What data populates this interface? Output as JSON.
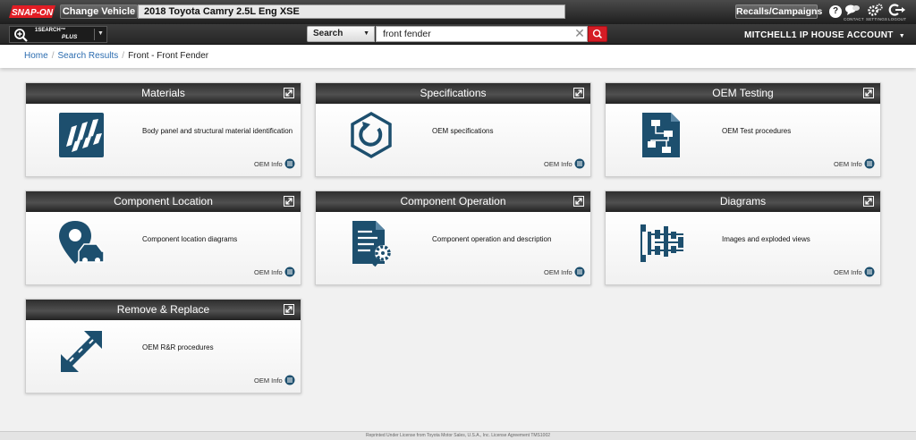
{
  "header": {
    "logo": "SNAP-ON",
    "change_vehicle": "Change Vehicle",
    "vehicle": "2018 Toyota Camry 2.5L Eng XSE",
    "recalls": "Recalls/Campaigns",
    "help": "?",
    "icons": [
      {
        "name": "contact-icon",
        "label": "CONTACT"
      },
      {
        "name": "settings-icon",
        "label": "SETTINGS"
      },
      {
        "name": "logout-icon",
        "label": "LOGOUT"
      }
    ]
  },
  "searchbar": {
    "onesearch_line1": "1SEARCH™",
    "onesearch_line2": "PLUS",
    "type_selected": "Search",
    "query": "front fender",
    "account": "MITCHELL1 IP HOUSE ACCOUNT"
  },
  "breadcrumb": {
    "items": [
      "Home",
      "Search Results",
      "Front - Front Fender"
    ]
  },
  "cards": [
    {
      "title": "Materials",
      "icon": "checkered-flag-icon",
      "desc": "Body panel and structural material identification",
      "oem": "OEM Info"
    },
    {
      "title": "Specifications",
      "icon": "bolt-rotation-icon",
      "desc": "OEM specifications",
      "oem": "OEM Info"
    },
    {
      "title": "OEM Testing",
      "icon": "flowchart-document-icon",
      "desc": "OEM Test procedures",
      "oem": "OEM Info"
    },
    {
      "title": "Component Location",
      "icon": "map-pin-car-icon",
      "desc": "Component location diagrams",
      "oem": "OEM Info"
    },
    {
      "title": "Component Operation",
      "icon": "document-gear-icon",
      "desc": "Component operation and description",
      "oem": "OEM Info"
    },
    {
      "title": "Diagrams",
      "icon": "exploded-view-icon",
      "desc": "Images and exploded views",
      "oem": "OEM Info"
    },
    {
      "title": "Remove & Replace",
      "icon": "swap-arrows-icon",
      "desc": "OEM R&R procedures",
      "oem": "OEM Info"
    }
  ],
  "footer": {
    "text": "Reprinted Under License from Toyota Motor Sales, U.S.A., Inc. License Agreement TMS1002"
  },
  "colors": {
    "accent_blue": "#1d4f6e",
    "search_red": "#d51c25",
    "link_blue": "#2b6cb0"
  }
}
